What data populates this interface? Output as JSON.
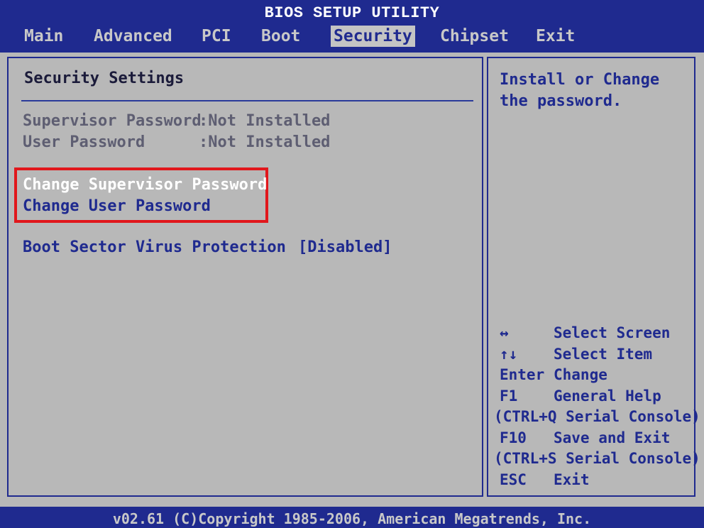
{
  "header": {
    "title": "BIOS SETUP UTILITY",
    "tabs": [
      {
        "label": "Main"
      },
      {
        "label": "Advanced"
      },
      {
        "label": "PCI"
      },
      {
        "label": "Boot"
      },
      {
        "label": "Security"
      },
      {
        "label": "Chipset"
      },
      {
        "label": "Exit"
      }
    ],
    "active_tab": "Security"
  },
  "left": {
    "section_title": "Security Settings",
    "info": [
      {
        "label": "Supervisor Password",
        "value": ":Not Installed"
      },
      {
        "label": "User Password",
        "value": ":Not Installed"
      }
    ],
    "menu": [
      {
        "label": "Change Supervisor Password"
      },
      {
        "label": "Change User Password"
      }
    ],
    "option": {
      "label": "Boot Sector Virus Protection",
      "value": "[Disabled]"
    }
  },
  "right": {
    "help": "Install or Change the password.",
    "keys": [
      {
        "key": "↔",
        "desc": "Select Screen"
      },
      {
        "key": "↑↓",
        "desc": "Select Item"
      },
      {
        "key": "Enter",
        "desc": "Change"
      },
      {
        "key": "F1",
        "desc": "General Help"
      },
      {
        "full": "(CTRL+Q Serial Console)"
      },
      {
        "key": "F10",
        "desc": "Save and Exit"
      },
      {
        "full": "(CTRL+S Serial Console)"
      },
      {
        "key": "ESC",
        "desc": "Exit"
      }
    ]
  },
  "footer": "v02.61 (C)Copyright 1985-2006, American Megatrends, Inc.",
  "colors": {
    "background_blue": "#1f2a8f",
    "panel_gray": "#b8b8b8",
    "highlight_red": "#e1171c",
    "selected_text": "#ffffff",
    "disabled_text": "#5e5e72"
  }
}
